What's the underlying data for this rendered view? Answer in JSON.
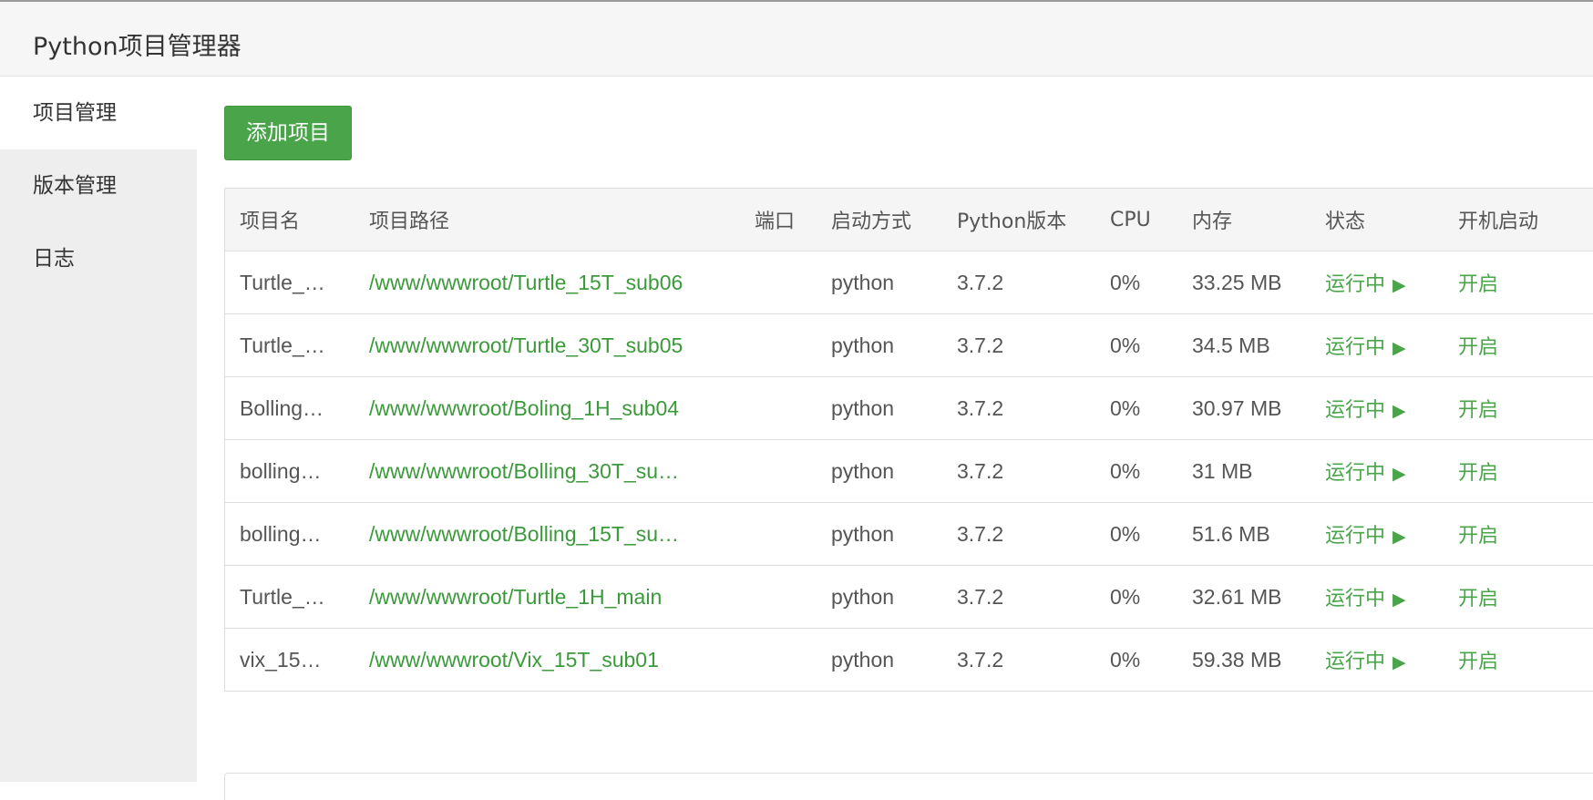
{
  "app": {
    "title": "Python项目管理器"
  },
  "sidebar": {
    "items": [
      {
        "label": "项目管理",
        "active": true
      },
      {
        "label": "版本管理",
        "active": false
      },
      {
        "label": "日志",
        "active": false
      }
    ]
  },
  "toolbar": {
    "add_label": "添加项目"
  },
  "table": {
    "headers": [
      "项目名",
      "项目路径",
      "端口",
      "启动方式",
      "Python版本",
      "CPU",
      "内存",
      "状态",
      "开机启动"
    ],
    "rows": [
      {
        "name": "Turtle_…",
        "path": "/www/wwwroot/Turtle_15T_sub06",
        "port": "",
        "mode": "python",
        "version": "3.7.2",
        "cpu": "0%",
        "memory": "33.25 MB",
        "status": "运行中",
        "boot": "开启"
      },
      {
        "name": "Turtle_…",
        "path": "/www/wwwroot/Turtle_30T_sub05",
        "port": "",
        "mode": "python",
        "version": "3.7.2",
        "cpu": "0%",
        "memory": "34.5 MB",
        "status": "运行中",
        "boot": "开启"
      },
      {
        "name": "Bolling…",
        "path": "/www/wwwroot/Boling_1H_sub04",
        "port": "",
        "mode": "python",
        "version": "3.7.2",
        "cpu": "0%",
        "memory": "30.97 MB",
        "status": "运行中",
        "boot": "开启"
      },
      {
        "name": "bolling…",
        "path": "/www/wwwroot/Bolling_30T_su…",
        "port": "",
        "mode": "python",
        "version": "3.7.2",
        "cpu": "0%",
        "memory": "31 MB",
        "status": "运行中",
        "boot": "开启"
      },
      {
        "name": "bolling…",
        "path": "/www/wwwroot/Bolling_15T_su…",
        "port": "",
        "mode": "python",
        "version": "3.7.2",
        "cpu": "0%",
        "memory": "51.6 MB",
        "status": "运行中",
        "boot": "开启"
      },
      {
        "name": "Turtle_…",
        "path": "/www/wwwroot/Turtle_1H_main",
        "port": "",
        "mode": "python",
        "version": "3.7.2",
        "cpu": "0%",
        "memory": "32.61 MB",
        "status": "运行中",
        "boot": "开启"
      },
      {
        "name": "vix_15…",
        "path": "/www/wwwroot/Vix_15T_sub01",
        "port": "",
        "mode": "python",
        "version": "3.7.2",
        "cpu": "0%",
        "memory": "59.38 MB",
        "status": "运行中",
        "boot": "开启"
      }
    ]
  },
  "icons": {
    "status": "play-icon"
  },
  "colors": {
    "accent": "#4aa44a",
    "link": "#3a9a3a",
    "sidebar_bg": "#eeeeee",
    "header_bg": "#f6f6f6"
  }
}
